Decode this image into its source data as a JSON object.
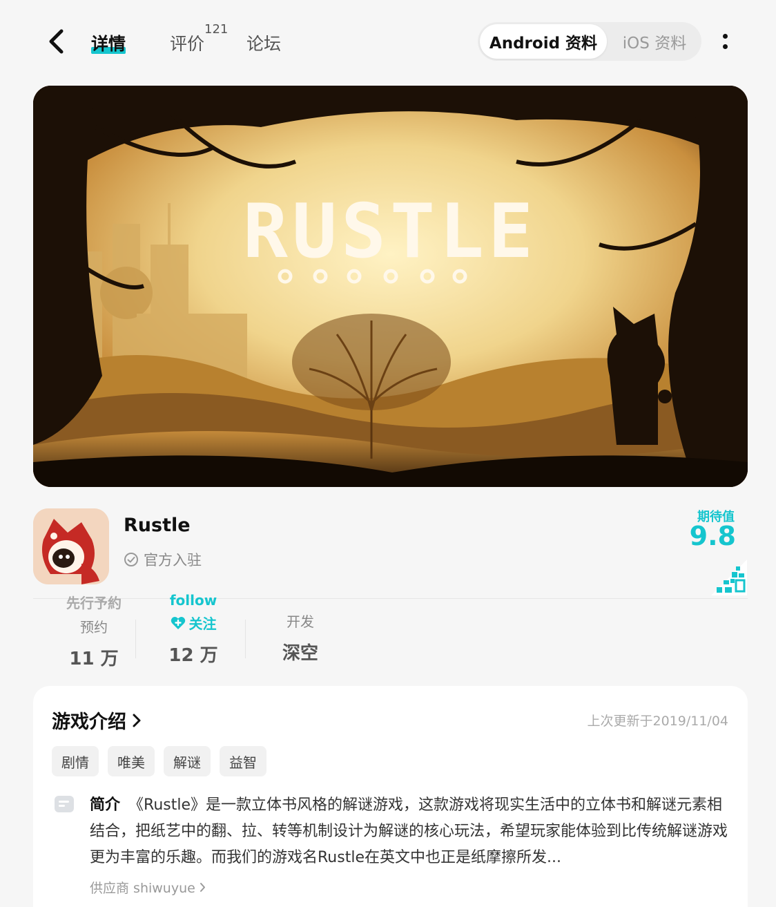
{
  "header": {
    "tabs": {
      "details": "详情",
      "reviews": "评价",
      "reviews_count": "121",
      "forum": "论坛"
    },
    "platform": {
      "android": "Android 资料",
      "ios": "iOS 资料"
    }
  },
  "banner": {
    "game_logo_text": "RUSTLE"
  },
  "app": {
    "name": "Rustle",
    "official_label": "官方入驻",
    "expect_label": "期待值",
    "expect_value": "9.8"
  },
  "stats": {
    "reserve": {
      "tag": "先行予約",
      "label": "预约",
      "value": "11 万"
    },
    "follow": {
      "tag": "follow",
      "label": "关注",
      "value": "12 万"
    },
    "developer": {
      "label": "开发",
      "value": "深空"
    }
  },
  "intro": {
    "title": "游戏介绍",
    "updated": "上次更新于2019/11/04",
    "tags": [
      "剧情",
      "唯美",
      "解谜",
      "益智"
    ],
    "desc_label": "简介",
    "description": "《Rustle》是一款立体书风格的解谜游戏，这款游戏将现实生活中的立体书和解谜元素相结合，把纸艺中的翻、拉、转等机制设计为解谜的核心玩法，希望玩家能体验到比传统解谜游戏更为丰富的乐趣。而我们的游戏名Rustle在英文中也正是纸摩擦所发...",
    "vendor": "供应商 shiwuyue"
  },
  "colors": {
    "accent": "#15c5ce",
    "background": "#f6f6f6"
  }
}
